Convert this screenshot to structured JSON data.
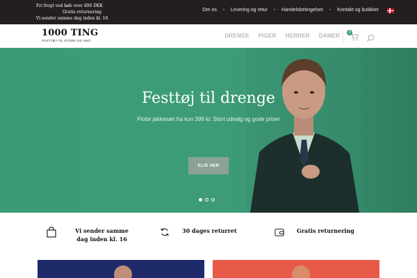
{
  "topbar": {
    "promo_lines": [
      "Fri  frogt ved køb over 400 DKK",
      "Gratis returnering",
      "Vi sender samme dag inden kl. 16"
    ],
    "nav": [
      "Om os",
      "Levering og retur",
      "Handelsbetingelser",
      "Kontakt og butikker"
    ],
    "flag_icon": "danish-flag-icon"
  },
  "header": {
    "logo_name": "1000 TING",
    "logo_tagline": "FESTTØJ TIL STORE OG SMÅ",
    "nav": [
      "DRENGE",
      "PIGER",
      "HERRER",
      "DAMER"
    ],
    "cart_count": "0",
    "cart_icon": "cart-icon",
    "search_icon": "search-icon",
    "accent": "#3a9f77"
  },
  "hero": {
    "title": "Festtøj til drenge",
    "subtitle": "Flotte jakkesæt fra kun 399 kr. Stort udvalg og gode priser",
    "cta": "KLIK HER",
    "slides": 3,
    "active_slide": 1,
    "background": "#3d9c77"
  },
  "features": [
    {
      "icon": "shopping-bag-icon",
      "text": "Vi sender samme dag inden kl. 16"
    },
    {
      "icon": "refresh-icon",
      "text": "30 dages returret"
    },
    {
      "icon": "wallet-icon",
      "text": "Gratis returnering"
    }
  ]
}
